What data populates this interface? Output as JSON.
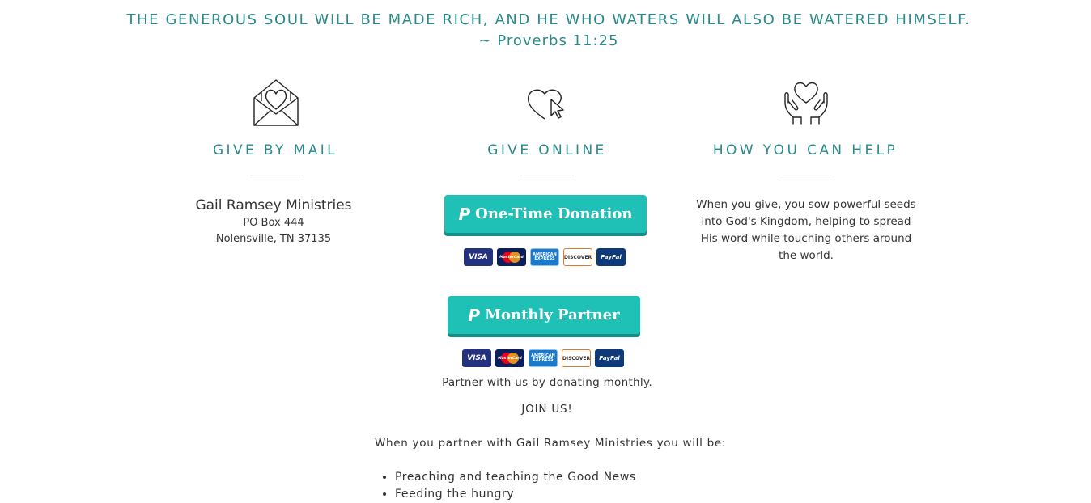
{
  "quote": {
    "text": "THE GENEROUS SOUL WILL BE MADE RICH, AND HE WHO WATERS WILL ALSO BE WATERED HIMSELF.",
    "reference": "~ Proverbs 11:25"
  },
  "mail": {
    "icon": "envelope-heart-icon",
    "title": "GIVE BY MAIL",
    "name": "Gail Ramsey Ministries",
    "address_line1": "PO Box 444",
    "address_line2": "Nolensville, TN 37135"
  },
  "online": {
    "icon": "heart-cursor-icon",
    "title": "GIVE ONLINE",
    "one_time_label": "One-Time Donation",
    "monthly_label": "Monthly Partner",
    "cards": {
      "visa": "VISA",
      "mastercard": "MasterCard",
      "amex": "AMERICAN EXPRESS",
      "discover": "DISCOVER",
      "paypal": "PayPal"
    },
    "partner_text": "Partner with us by donating monthly.",
    "join_text": "JOIN US!",
    "intro_text": "When you partner with Gail Ramsey Ministries you will be:",
    "benefits": [
      "Preaching and teaching the Good News",
      "Feeding the hungry"
    ]
  },
  "help": {
    "icon": "hands-heart-icon",
    "title": "HOW YOU CAN HELP",
    "text_line1": "When you give, you sow powerful seeds",
    "text_line2": "into God's Kingdom, helping to spread",
    "text_line3": "His word while touching others around",
    "text_line4": "the world."
  },
  "colors": {
    "accent_teal": "#2a8a8a",
    "button_teal": "#1fc1b6"
  }
}
